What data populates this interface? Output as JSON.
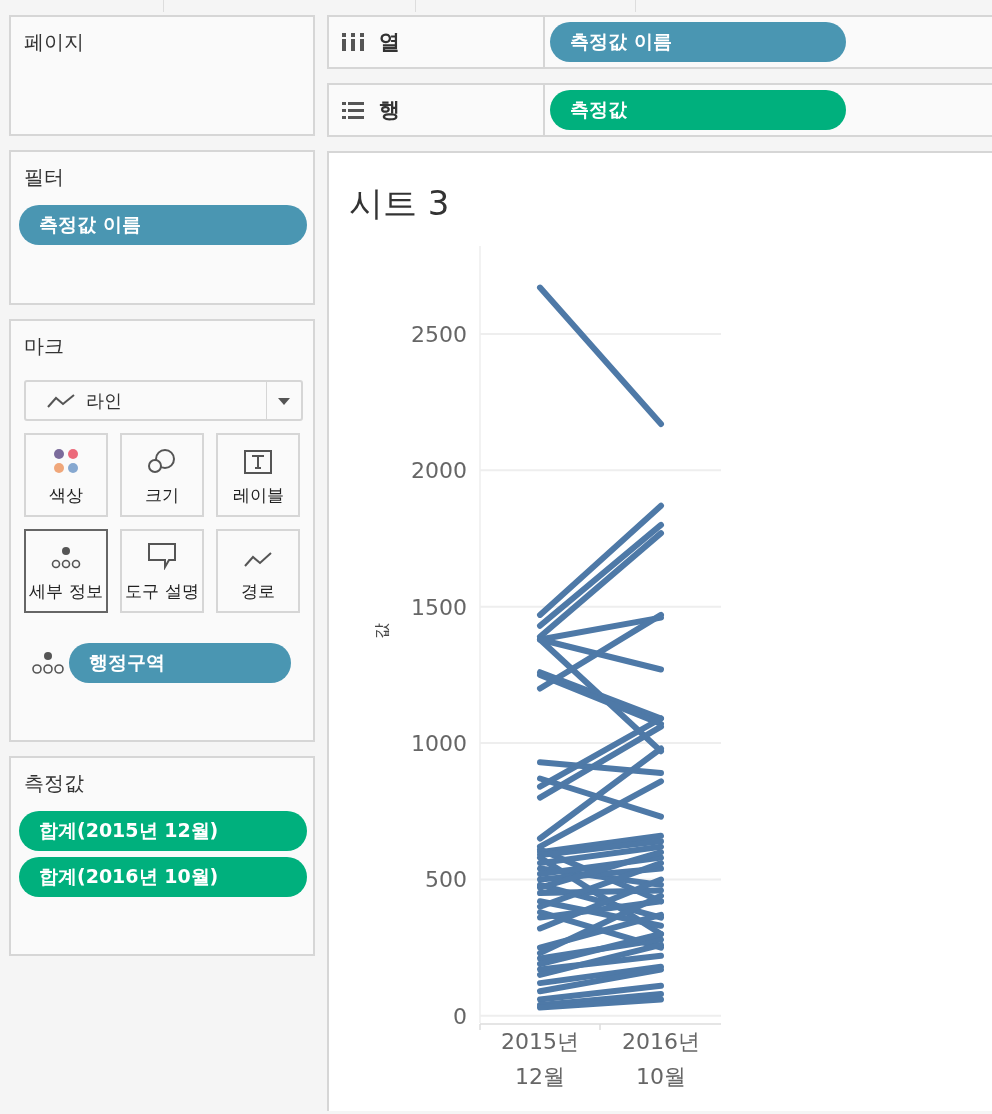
{
  "columns_shelf": {
    "label": "열",
    "pills": [
      {
        "label": "측정값 이름",
        "kind": "dimension"
      }
    ]
  },
  "rows_shelf": {
    "label": "행",
    "pills": [
      {
        "label": "측정값",
        "kind": "measure"
      }
    ]
  },
  "pages_card": {
    "title": "페이지"
  },
  "filters_card": {
    "title": "필터",
    "pills": [
      {
        "label": "측정값 이름",
        "kind": "dimension"
      }
    ]
  },
  "marks_card": {
    "title": "마크",
    "mark_type": "라인",
    "buttons": [
      {
        "label": "색상",
        "kind": "color",
        "selected": false
      },
      {
        "label": "크기",
        "kind": "size",
        "selected": false
      },
      {
        "label": "레이블",
        "kind": "label",
        "selected": false
      },
      {
        "label": "세부 정보",
        "kind": "detail",
        "selected": true
      },
      {
        "label": "도구 설명",
        "kind": "tooltip",
        "selected": false
      },
      {
        "label": "경로",
        "kind": "path",
        "selected": false
      }
    ],
    "fields": [
      {
        "label": "행정구역",
        "kind": "dimension"
      }
    ]
  },
  "measure_values_card": {
    "title": "측정값",
    "pills": [
      {
        "label": "합계(2015년 12월)",
        "kind": "measure"
      },
      {
        "label": "합계(2016년 10월)",
        "kind": "measure"
      }
    ]
  },
  "sheet": {
    "title": "시트 3",
    "chart_data": {
      "type": "line",
      "grid": true,
      "ylabel": "값",
      "categories": [
        "2015년 12월",
        "2016년 10월"
      ],
      "ylim": [
        -30,
        2830
      ],
      "yticks": [
        0,
        500,
        1000,
        1500,
        2000,
        2500
      ],
      "series": [
        {
          "color": "#4e79a7",
          "values": [
            2670,
            2170
          ]
        },
        {
          "color": "#4e79a7",
          "values": [
            1470,
            1870
          ]
        },
        {
          "color": "#4e79a7",
          "values": [
            1430,
            1800
          ]
        },
        {
          "color": "#4e79a7",
          "values": [
            1390,
            1770
          ]
        },
        {
          "color": "#4e79a7",
          "values": [
            1380,
            1460
          ]
        },
        {
          "color": "#4e79a7",
          "values": [
            1380,
            1270
          ]
        },
        {
          "color": "#4e79a7",
          "values": [
            1380,
            970
          ]
        },
        {
          "color": "#4e79a7",
          "values": [
            1260,
            1090
          ]
        },
        {
          "color": "#4e79a7",
          "values": [
            1250,
            1070
          ]
        },
        {
          "color": "#4e79a7",
          "values": [
            1200,
            1470
          ]
        },
        {
          "color": "#4e79a7",
          "values": [
            930,
            890
          ]
        },
        {
          "color": "#4e79a7",
          "values": [
            870,
            730
          ]
        },
        {
          "color": "#4e79a7",
          "values": [
            840,
            1090
          ]
        },
        {
          "color": "#4e79a7",
          "values": [
            800,
            1060
          ]
        },
        {
          "color": "#4e79a7",
          "values": [
            650,
            980
          ]
        },
        {
          "color": "#4e79a7",
          "values": [
            620,
            860
          ]
        },
        {
          "color": "#4e79a7",
          "values": [
            610,
            420
          ]
        },
        {
          "color": "#4e79a7",
          "values": [
            600,
            660
          ]
        },
        {
          "color": "#4e79a7",
          "values": [
            590,
            640
          ]
        },
        {
          "color": "#4e79a7",
          "values": [
            580,
            300
          ]
        },
        {
          "color": "#4e79a7",
          "values": [
            560,
            620
          ]
        },
        {
          "color": "#4e79a7",
          "values": [
            540,
            480
          ]
        },
        {
          "color": "#4e79a7",
          "values": [
            520,
            580
          ]
        },
        {
          "color": "#4e79a7",
          "values": [
            500,
            540
          ]
        },
        {
          "color": "#4e79a7",
          "values": [
            480,
            360
          ]
        },
        {
          "color": "#4e79a7",
          "values": [
            470,
            600
          ]
        },
        {
          "color": "#4e79a7",
          "values": [
            450,
            460
          ]
        },
        {
          "color": "#4e79a7",
          "values": [
            420,
            330
          ]
        },
        {
          "color": "#4e79a7",
          "values": [
            400,
            560
          ]
        },
        {
          "color": "#4e79a7",
          "values": [
            380,
            250
          ]
        },
        {
          "color": "#4e79a7",
          "values": [
            360,
            420
          ]
        },
        {
          "color": "#4e79a7",
          "values": [
            320,
            500
          ]
        },
        {
          "color": "#4e79a7",
          "values": [
            250,
            370
          ]
        },
        {
          "color": "#4e79a7",
          "values": [
            230,
            440
          ]
        },
        {
          "color": "#4e79a7",
          "values": [
            210,
            280
          ]
        },
        {
          "color": "#4e79a7",
          "values": [
            190,
            300
          ]
        },
        {
          "color": "#4e79a7",
          "values": [
            170,
            220
          ]
        },
        {
          "color": "#4e79a7",
          "values": [
            150,
            260
          ]
        },
        {
          "color": "#4e79a7",
          "values": [
            120,
            180
          ]
        },
        {
          "color": "#4e79a7",
          "values": [
            90,
            170
          ]
        },
        {
          "color": "#4e79a7",
          "values": [
            60,
            110
          ]
        },
        {
          "color": "#4e79a7",
          "values": [
            40,
            80
          ]
        },
        {
          "color": "#4e79a7",
          "values": [
            30,
            60
          ]
        }
      ]
    }
  }
}
